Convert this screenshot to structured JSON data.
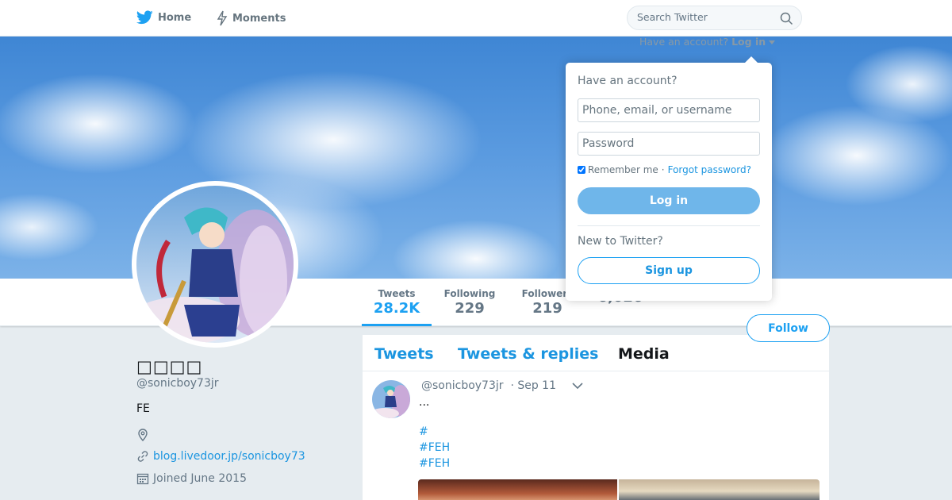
{
  "topbar": {
    "home_label": "Home",
    "moments_label": "Moments",
    "search_placeholder": "Search Twitter",
    "login_prompt": "Have an account?",
    "login_link": "Log in"
  },
  "profile": {
    "name": "□□□□",
    "handle": "@sonicboy73jr",
    "bio": "FE",
    "location": "",
    "url": "blog.livedoor.jp/sonicboy73",
    "joined": "Joined June 2015"
  },
  "stats": [
    {
      "label": "Tweets",
      "value": "28.2K"
    },
    {
      "label": "Following",
      "value": "229"
    },
    {
      "label": "Followers",
      "value": "219"
    },
    {
      "label": "",
      "value": "6,026"
    }
  ],
  "follow_label": "Follow",
  "timeline": {
    "tabs": [
      "Tweets",
      "Tweets & replies",
      "Media"
    ],
    "tweet": {
      "handle": "@sonicboy73jr",
      "date": "· Sep 11",
      "ellipsis": "...",
      "hashtags": [
        "#",
        "#FEH",
        "#FEH"
      ]
    }
  },
  "login_dropdown": {
    "title": "Have an account?",
    "username_placeholder": "Phone, email, or username",
    "password_placeholder": "Password",
    "remember_label": "Remember me",
    "separator": "·",
    "forgot_label": "Forgot password?",
    "login_button": "Log in",
    "new_prompt": "New to Twitter?",
    "signup_button": "Sign up"
  },
  "colors": {
    "brand_blue": "#1da1f2",
    "link_blue": "#1b95e0"
  }
}
